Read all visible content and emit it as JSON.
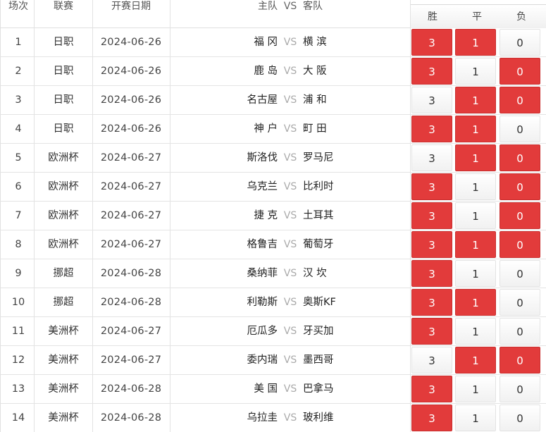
{
  "header": {
    "idx": "场次",
    "league": "联赛",
    "date": "开赛日期",
    "home": "主队",
    "vs": "VS",
    "away": "客队",
    "win": "胜",
    "draw": "平",
    "lose": "负"
  },
  "colors": {
    "selected": "#e23b3b",
    "unselected": "#f4f4f4"
  },
  "rows": [
    {
      "idx": "1",
      "league": "日职",
      "date": "2024-06-26",
      "home": "福 冈",
      "vs": "VS",
      "away": "横 滨",
      "win": "3",
      "draw": "1",
      "lose": "0",
      "sel": [
        true,
        true,
        false
      ]
    },
    {
      "idx": "2",
      "league": "日职",
      "date": "2024-06-26",
      "home": "鹿 岛",
      "vs": "VS",
      "away": "大 阪",
      "win": "3",
      "draw": "1",
      "lose": "0",
      "sel": [
        true,
        false,
        true
      ]
    },
    {
      "idx": "3",
      "league": "日职",
      "date": "2024-06-26",
      "home": "名古屋",
      "vs": "VS",
      "away": "浦 和",
      "win": "3",
      "draw": "1",
      "lose": "0",
      "sel": [
        false,
        true,
        true
      ]
    },
    {
      "idx": "4",
      "league": "日职",
      "date": "2024-06-26",
      "home": "神 户",
      "vs": "VS",
      "away": "町 田",
      "win": "3",
      "draw": "1",
      "lose": "0",
      "sel": [
        true,
        true,
        false
      ]
    },
    {
      "idx": "5",
      "league": "欧洲杯",
      "date": "2024-06-27",
      "home": "斯洛伐",
      "vs": "VS",
      "away": "罗马尼",
      "win": "3",
      "draw": "1",
      "lose": "0",
      "sel": [
        false,
        true,
        true
      ]
    },
    {
      "idx": "6",
      "league": "欧洲杯",
      "date": "2024-06-27",
      "home": "乌克兰",
      "vs": "VS",
      "away": "比利时",
      "win": "3",
      "draw": "1",
      "lose": "0",
      "sel": [
        true,
        false,
        true
      ]
    },
    {
      "idx": "7",
      "league": "欧洲杯",
      "date": "2024-06-27",
      "home": "捷 克",
      "vs": "VS",
      "away": "土耳其",
      "win": "3",
      "draw": "1",
      "lose": "0",
      "sel": [
        true,
        false,
        true
      ]
    },
    {
      "idx": "8",
      "league": "欧洲杯",
      "date": "2024-06-27",
      "home": "格鲁吉",
      "vs": "VS",
      "away": "葡萄牙",
      "win": "3",
      "draw": "1",
      "lose": "0",
      "sel": [
        true,
        true,
        true
      ]
    },
    {
      "idx": "9",
      "league": "挪超",
      "date": "2024-06-28",
      "home": "桑纳菲",
      "vs": "VS",
      "away": "汉 坎",
      "win": "3",
      "draw": "1",
      "lose": "0",
      "sel": [
        true,
        false,
        false
      ]
    },
    {
      "idx": "10",
      "league": "挪超",
      "date": "2024-06-28",
      "home": "利勒斯",
      "vs": "VS",
      "away": "奥斯KF",
      "win": "3",
      "draw": "1",
      "lose": "0",
      "sel": [
        true,
        true,
        false
      ]
    },
    {
      "idx": "11",
      "league": "美洲杯",
      "date": "2024-06-27",
      "home": "厄瓜多",
      "vs": "VS",
      "away": "牙买加",
      "win": "3",
      "draw": "1",
      "lose": "0",
      "sel": [
        true,
        false,
        false
      ]
    },
    {
      "idx": "12",
      "league": "美洲杯",
      "date": "2024-06-27",
      "home": "委内瑞",
      "vs": "VS",
      "away": "墨西哥",
      "win": "3",
      "draw": "1",
      "lose": "0",
      "sel": [
        false,
        true,
        true
      ]
    },
    {
      "idx": "13",
      "league": "美洲杯",
      "date": "2024-06-28",
      "home": "美 国",
      "vs": "VS",
      "away": "巴拿马",
      "win": "3",
      "draw": "1",
      "lose": "0",
      "sel": [
        true,
        false,
        false
      ]
    },
    {
      "idx": "14",
      "league": "美洲杯",
      "date": "2024-06-28",
      "home": "乌拉圭",
      "vs": "VS",
      "away": "玻利维",
      "win": "3",
      "draw": "1",
      "lose": "0",
      "sel": [
        true,
        false,
        false
      ]
    }
  ]
}
